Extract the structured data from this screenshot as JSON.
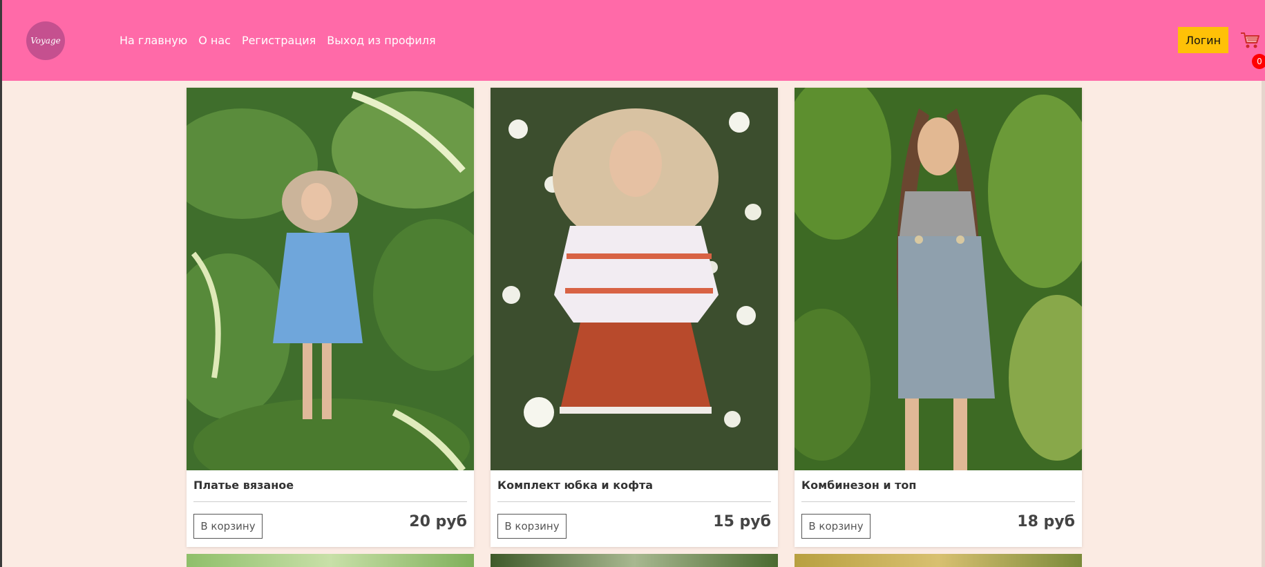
{
  "brand": {
    "logo_text": "Voyage"
  },
  "nav": {
    "links": [
      "На главную",
      "О нас",
      "Регистрация",
      "Выход из профиля"
    ]
  },
  "header": {
    "login_label": "Логин",
    "cart_count": "0"
  },
  "colors": {
    "navbar": "#ff6aa8",
    "background": "#fbebe3",
    "login_button": "#ffc107",
    "badge": "#ff0000"
  },
  "products": [
    {
      "title": "Платье вязаное",
      "button": "В корзину",
      "price": "20 руб"
    },
    {
      "title": "Комплект юбка и кофта",
      "button": "В корзину",
      "price": "15 руб"
    },
    {
      "title": "Комбинезон и топ",
      "button": "В корзину",
      "price": "18 руб"
    }
  ],
  "icons": {
    "cart": "shopping-cart-icon"
  }
}
